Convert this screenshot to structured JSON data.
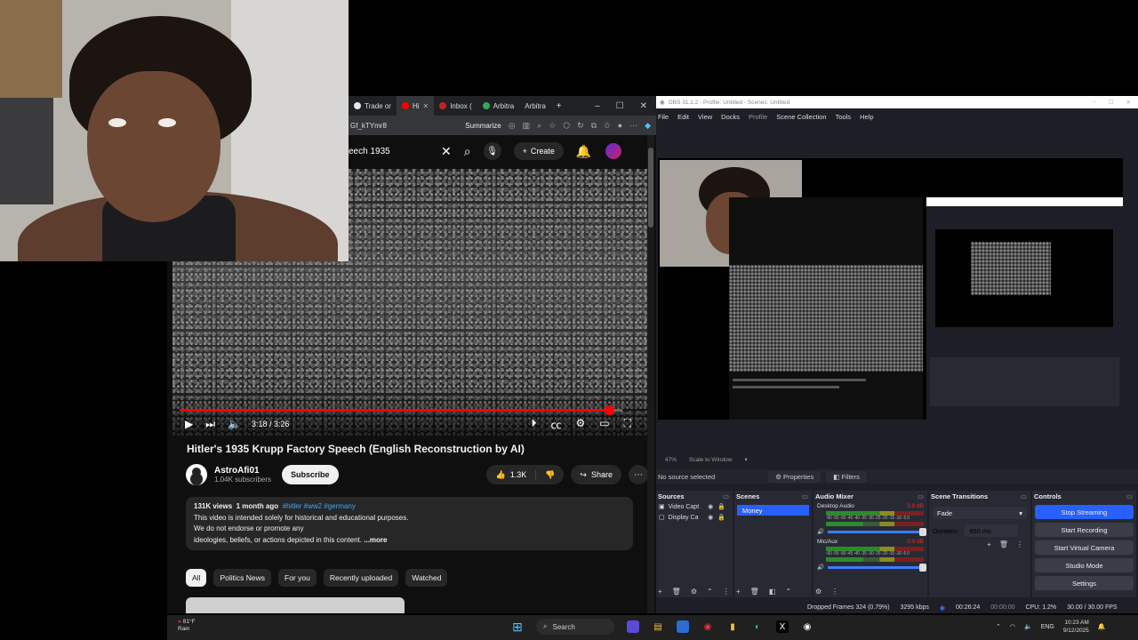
{
  "browser": {
    "tabs": [
      {
        "label": "Trade or",
        "color": "#e8e8e8"
      },
      {
        "label": "Hi",
        "color": "#ff0000"
      },
      {
        "label": "Inbox (",
        "color": "#c5221f"
      },
      {
        "label": "Arbitra",
        "color": "#34a853"
      },
      {
        "label": "Arbitra",
        "color": "#666666"
      }
    ],
    "new_tab": "+",
    "url": "Gf_kTYmr8",
    "summarize": "Summarize"
  },
  "youtube": {
    "search_text": "eech 1935",
    "create_label": "Create",
    "video": {
      "progress": 0.97,
      "time": "3:18 / 3:26"
    },
    "title": "Hitler's 1935 Krupp Factory Speech (English Reconstruction by AI)",
    "channel": {
      "name": "AstroAfi01",
      "subscribers": "1.04K subscribers",
      "subscribe_label": "Subscribe"
    },
    "likes": "1.3K",
    "share_label": "Share",
    "description": {
      "views": "131K views",
      "age": "1 month ago",
      "tags": "#hitler #ww2 #germany",
      "line1": "This video is intended solely for historical and educational purposes.",
      "line2": "We do not endorse or promote any",
      "line3": "ideologies, beliefs, or actions depicted in this content.",
      "more": "...more"
    },
    "chips": [
      "All",
      "Politics News",
      "For you",
      "Recently uploaded",
      "Watched"
    ]
  },
  "obs": {
    "title": "OBS 31.1.2 - Profile: Untitled - Scenes: Untitled",
    "menu": [
      "File",
      "Edit",
      "View",
      "Docks",
      "Profile",
      "Scene Collection",
      "Tools",
      "Help"
    ],
    "zoom": "47%",
    "scale_to_window": "Scale to Window",
    "no_source": "No source selected",
    "properties": "Properties",
    "filters": "Filters",
    "sources_header": "Sources",
    "sources": [
      "Video Capt",
      "Display Ca"
    ],
    "scenes_header": "Scenes",
    "scenes": [
      "Money"
    ],
    "mixer_header": "Audio Mixer",
    "mixer": [
      {
        "name": "Desktop Audio",
        "db": "0.0 dB"
      },
      {
        "name": "Mic/Aux",
        "db": "0.0 dB"
      }
    ],
    "meter_scale": "-60 -55 -50 -45 -40 -35 -30 -25 -20 -15 -10 -5 0",
    "transitions_header": "Scene Transitions",
    "transition": "Fade",
    "duration_label": "Duration",
    "duration": "850 ms",
    "controls_header": "Controls",
    "controls": [
      "Stop Streaming",
      "Start Recording",
      "Start Virtual Camera",
      "Studio Mode",
      "Settings"
    ],
    "status": {
      "dropped": "Dropped Frames 324 (0.79%)",
      "bitrate": "3295 kbps",
      "stream_time": "00:26:24",
      "rec_time": "00:00:00",
      "cpu": "CPU: 1.2%",
      "fps": "30.00 / 30.00 FPS"
    }
  },
  "taskbar": {
    "temp": "81°F",
    "weather": "Rain",
    "search": "Search",
    "lang": "ENG",
    "time": "10:23 AM",
    "date": "9/12/2025"
  }
}
